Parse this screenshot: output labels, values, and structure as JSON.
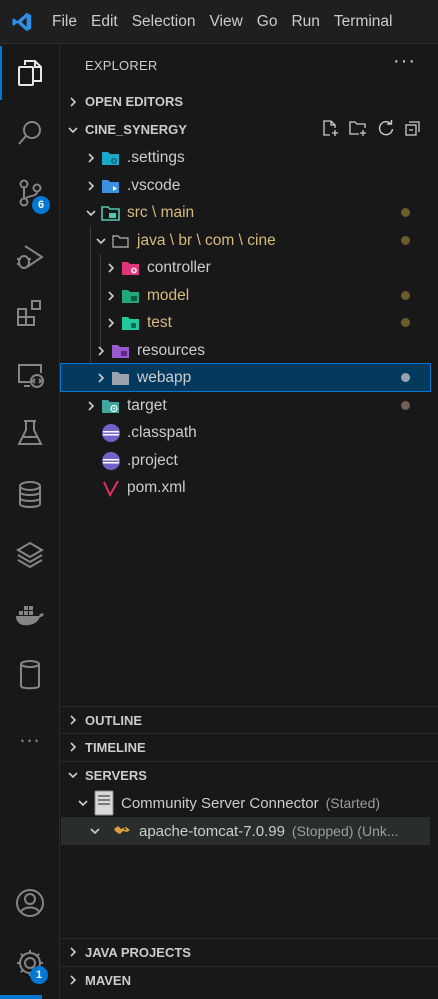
{
  "menu": [
    "File",
    "Edit",
    "Selection",
    "View",
    "Go",
    "Run",
    "Terminal"
  ],
  "activity": {
    "scm_badge": "6",
    "settings_badge": "1",
    "more_label": "..."
  },
  "explorer": {
    "title": "EXPLORER",
    "more": "···",
    "open_editors": "OPEN EDITORS",
    "project": "CINE_SYNERGY",
    "tree": {
      "settings": ".settings",
      "vscode": ".vscode",
      "src_main": "src \\ main",
      "java_pkg": "java \\ br \\ com \\ cine",
      "controller": "controller",
      "model": "model",
      "test": "test",
      "resources": "resources",
      "webapp": "webapp",
      "target": "target",
      "classpath": ".classpath",
      "project_file": ".project",
      "pom": "pom.xml"
    },
    "outline": "OUTLINE",
    "timeline": "TIMELINE",
    "servers": "SERVERS",
    "connector": "Community Server Connector",
    "connector_status": "(Started)",
    "tomcat": "apache-tomcat-7.0.99",
    "tomcat_status": "(Stopped) (Unk...",
    "java_projects": "JAVA PROJECTS",
    "maven": "MAVEN"
  }
}
